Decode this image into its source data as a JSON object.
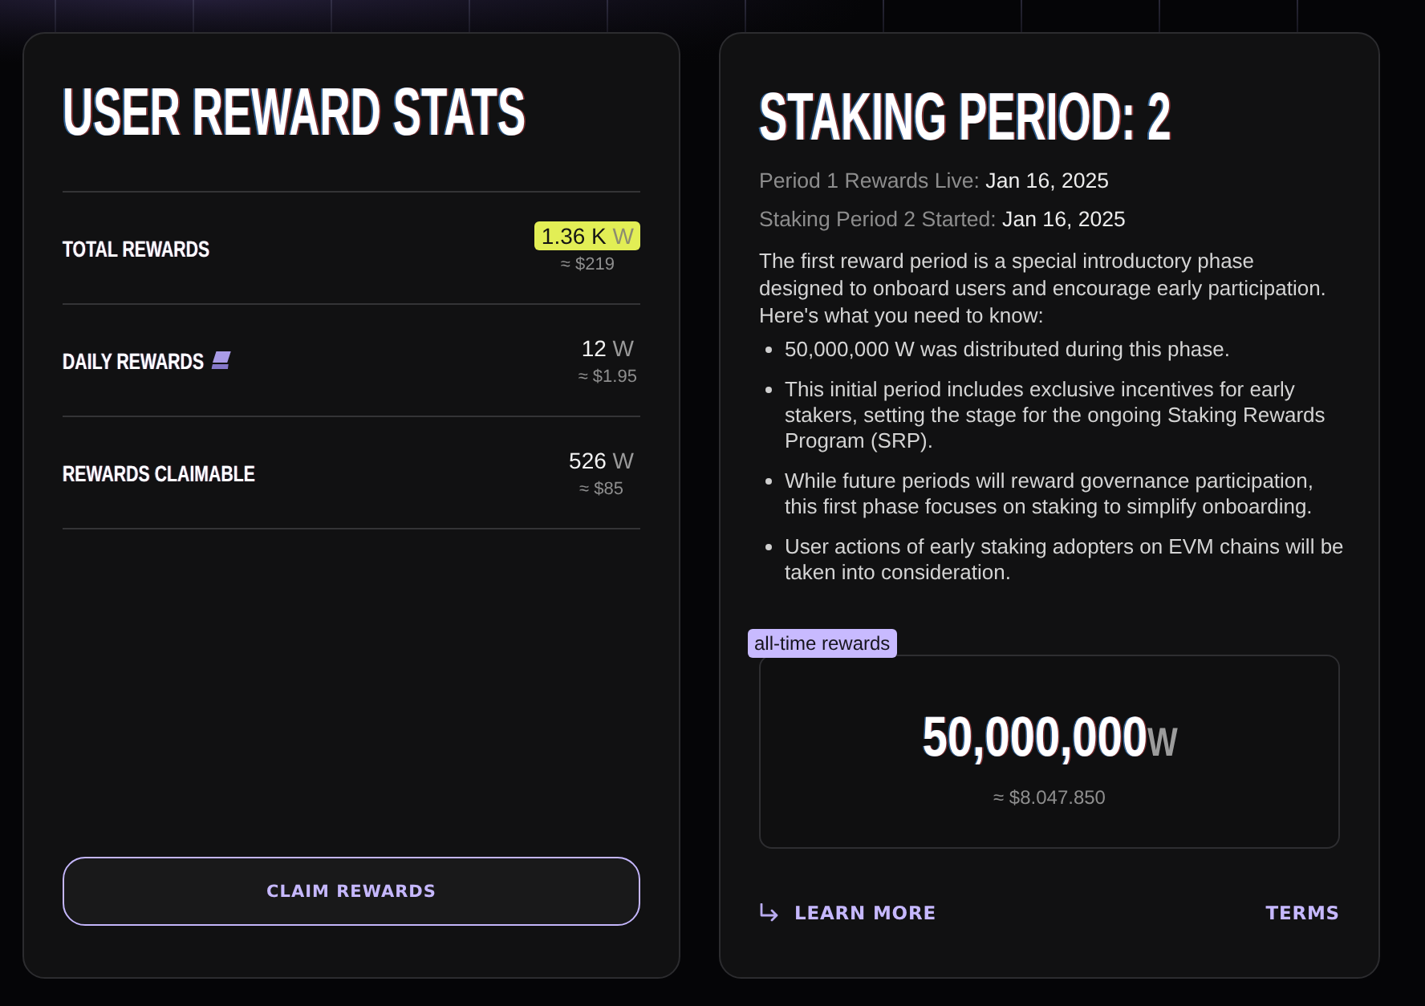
{
  "stats_card": {
    "title": "USER REWARD STATS",
    "rows": [
      {
        "label": "TOTAL REWARDS",
        "kind": "plain",
        "value": "1.36 K",
        "unit": "W",
        "highlighted": true,
        "usd": "≈ $219"
      },
      {
        "label": "DAILY REWARDS",
        "kind": "with_icon",
        "value": "12",
        "unit": "W",
        "highlighted": false,
        "usd": "≈ $1.95"
      },
      {
        "label": "REWARDS CLAIMABLE",
        "kind": "plain",
        "value": "526",
        "unit": "W",
        "highlighted": false,
        "usd": "≈ $85"
      }
    ],
    "claim_button": "CLAIM REWARDS"
  },
  "period_card": {
    "title": "STAKING PERIOD: 2",
    "dates": [
      {
        "label": "Period 1 Rewards Live:",
        "value": "Jan 16, 2025"
      },
      {
        "label": "Staking Period 2 Started:",
        "value": "Jan 16, 2025"
      }
    ],
    "intro": "The first reward period is a special introductory phase designed to onboard users and encourage early participation. Here's what you need to know:",
    "bullets": [
      "50,000,000 W was distributed during this phase.",
      "This initial period includes exclusive incentives for early stakers, setting the stage for the ongoing Staking Rewards Program (SRP).",
      "While future periods will reward governance participation, this first phase focuses on staking to simplify onboarding.",
      "User actions of early staking adopters on EVM chains will be taken into consideration."
    ],
    "total": {
      "badge": "all-time rewards",
      "amount": "50,000,000",
      "unit": "W",
      "usd": "≈ $8.047.850"
    },
    "links": [
      {
        "label": "LEARN MORE",
        "kind": "arrow"
      },
      {
        "label": "TERMS",
        "kind": "plain"
      }
    ]
  }
}
